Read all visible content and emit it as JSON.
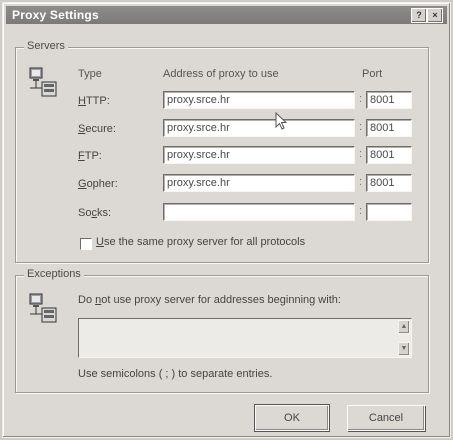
{
  "window": {
    "title": "Proxy Settings",
    "help_button": "?",
    "close_button": "×"
  },
  "servers": {
    "legend": "Servers",
    "icon": "network-computer-icon",
    "headers": {
      "type": "Type",
      "address": "Address of proxy to use",
      "port": "Port"
    },
    "rows": [
      {
        "pre": "",
        "accel": "H",
        "post": "TTP:",
        "address": "proxy.srce.hr",
        "port": "8001"
      },
      {
        "pre": "",
        "accel": "S",
        "post": "ecure:",
        "address": "proxy.srce.hr",
        "port": "8001"
      },
      {
        "pre": "",
        "accel": "F",
        "post": "TP:",
        "address": "proxy.srce.hr",
        "port": "8001"
      },
      {
        "pre": "",
        "accel": "G",
        "post": "opher:",
        "address": "proxy.srce.hr",
        "port": "8001"
      },
      {
        "pre": "So",
        "accel": "c",
        "post": "ks:",
        "address": "",
        "port": ""
      }
    ],
    "same_proxy": {
      "accel": "U",
      "rest": "se the same proxy server for all protocols",
      "checked": false
    }
  },
  "exceptions": {
    "legend": "Exceptions",
    "icon": "network-computer-icon",
    "desc_pre": "Do ",
    "desc_accel": "n",
    "desc_post": "ot use proxy server for addresses beginning with:",
    "value": "",
    "hint": "Use semicolons ( ; ) to separate entries."
  },
  "buttons": {
    "ok": "OK",
    "cancel": "Cancel"
  }
}
